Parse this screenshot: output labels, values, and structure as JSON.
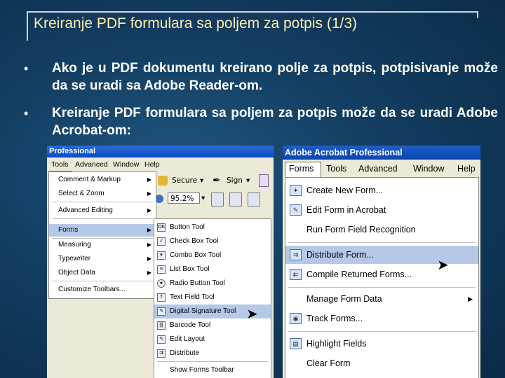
{
  "slide": {
    "title": "Kreiranje PDF formulara sa poljem za potpis (1/3)",
    "bullet_symbol": "•",
    "bullet1": "Ako je u PDF dokumentu kreirano polje za potpis, potpisivanje može da se uradi sa Adobe Reader-om.",
    "bullet2": "Kreiranje PDF formulara sa poljem za potpis može da se uradi Adobe Acrobat-om:"
  },
  "left_shot": {
    "title": "Professional",
    "menubar": [
      "Tools",
      "Advanced",
      "Window",
      "Help"
    ],
    "toolbar": {
      "secure": "Secure",
      "sign": "Sign",
      "zoom": "95.2%"
    },
    "tools_menu": [
      {
        "label": "Comment & Markup",
        "sub": true
      },
      {
        "label": "Select & Zoom",
        "sub": true
      },
      {
        "label": "Advanced Editing",
        "sub": true
      },
      {
        "label": "Forms",
        "sub": true,
        "selected": true
      },
      {
        "label": "Measuring",
        "sub": true
      },
      {
        "label": "Typewriter",
        "sub": true
      },
      {
        "label": "Object Data",
        "sub": true
      },
      {
        "label": "Customize Toolbars..."
      }
    ],
    "forms_submenu": [
      {
        "label": "Button Tool",
        "icon": "button-icon"
      },
      {
        "label": "Check Box Tool",
        "icon": "checkbox-icon"
      },
      {
        "label": "Combo Box Tool",
        "icon": "combobox-icon"
      },
      {
        "label": "List Box Tool",
        "icon": "listbox-icon"
      },
      {
        "label": "Radio Button Tool",
        "icon": "radio-icon"
      },
      {
        "label": "Text Field Tool",
        "icon": "textfield-icon"
      },
      {
        "label": "Digital Signature Tool",
        "icon": "signature-icon",
        "selected": true
      },
      {
        "label": "Barcode Tool",
        "icon": "barcode-icon"
      },
      {
        "label": "Edit Layout",
        "icon": "edit-layout-icon"
      },
      {
        "label": "Distribute",
        "icon": "distribute-icon"
      },
      {
        "label": "Show Forms Toolbar"
      }
    ]
  },
  "right_shot": {
    "title": "Adobe Acrobat Professional",
    "menubar": [
      "Forms",
      "Tools",
      "Advanced",
      "Window",
      "Help"
    ],
    "forms_menu": [
      {
        "label": "Create New Form...",
        "icon": "create-form-icon"
      },
      {
        "label": "Edit Form in Acrobat",
        "icon": "edit-form-icon"
      },
      {
        "label": "Run Form Field Recognition"
      },
      {
        "label": "Distribute Form...",
        "icon": "distribute-form-icon",
        "selected": true
      },
      {
        "label": "Compile Returned Forms...",
        "icon": "compile-forms-icon"
      },
      {
        "label": "Manage Form Data",
        "sub": true
      },
      {
        "label": "Track Forms...",
        "icon": "track-forms-icon"
      },
      {
        "label": "Highlight Fields",
        "icon": "highlight-fields-icon"
      },
      {
        "label": "Clear Form"
      }
    ]
  },
  "colors": {
    "background": "#143f63",
    "title_text": "#fff0b0",
    "menu_highlight": "#b5c8e8",
    "titlebar_blue": "#0b4bc0"
  }
}
